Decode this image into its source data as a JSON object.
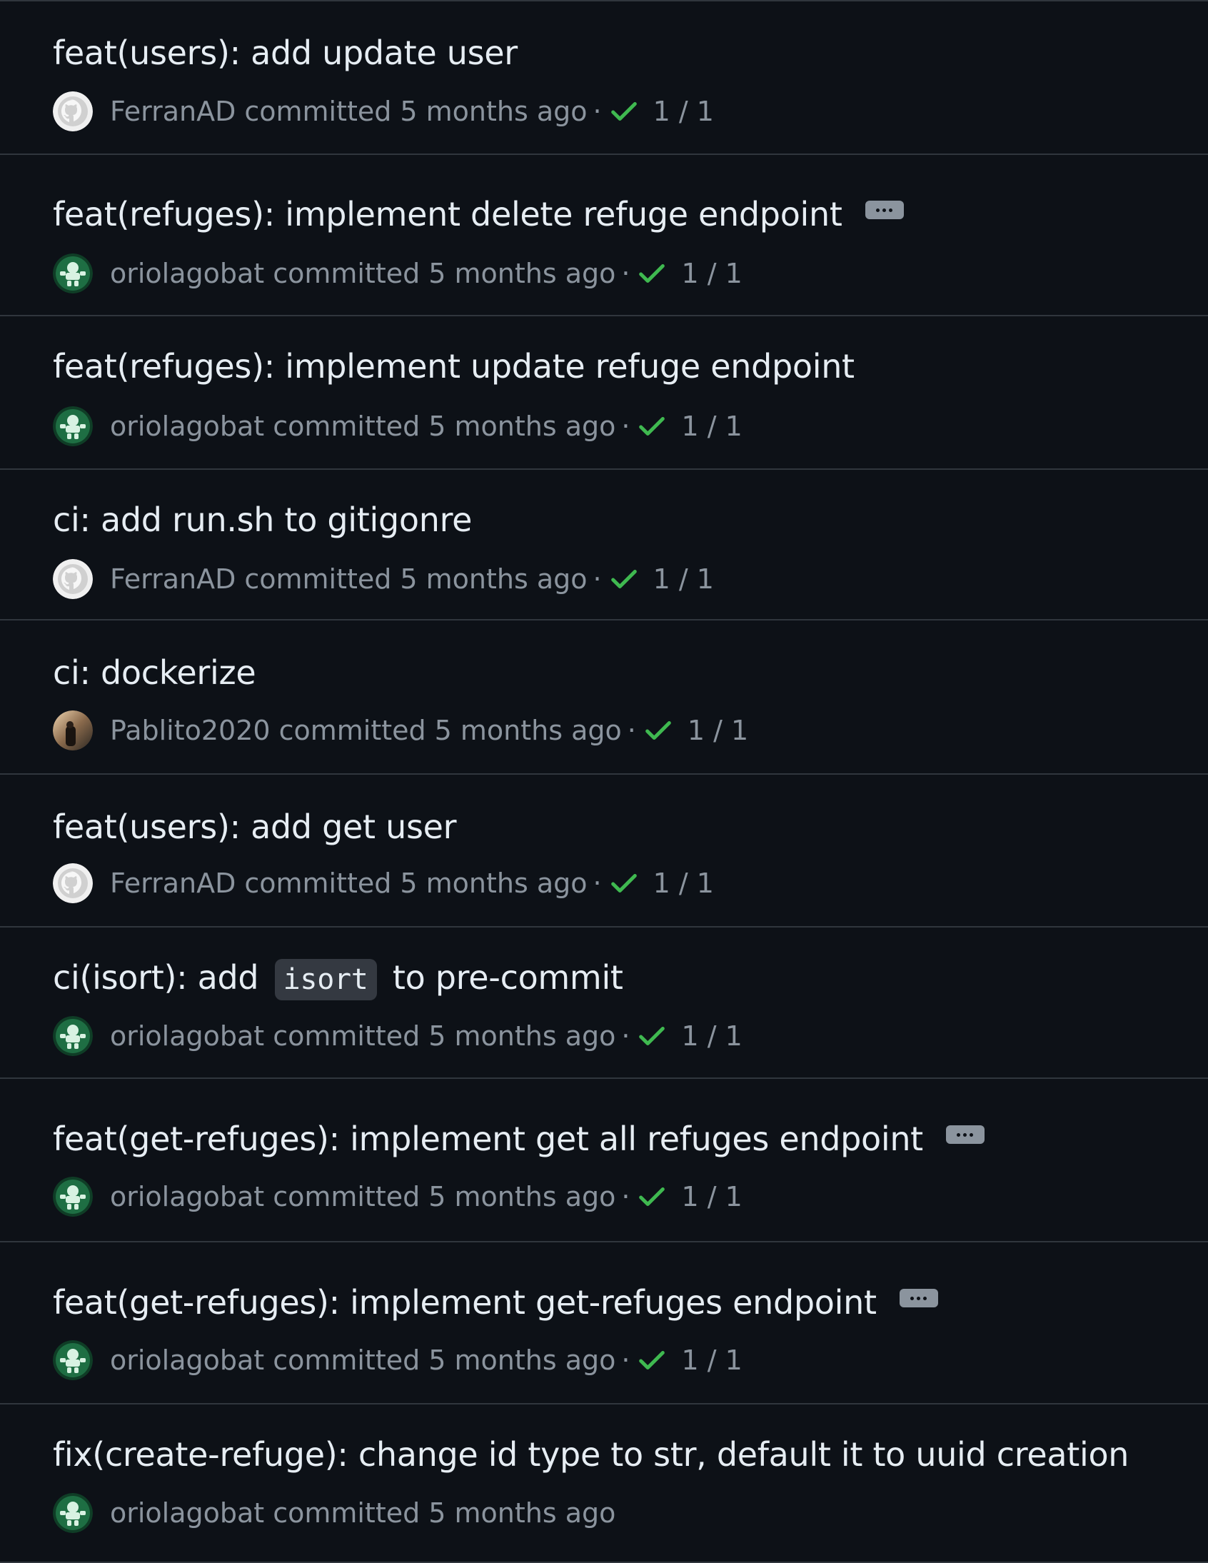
{
  "commits": [
    {
      "title": "feat(users): add update user",
      "title_parts": [],
      "author": "FerranAD",
      "committed_label": "committed",
      "time": "5 months ago",
      "status": "1 / 1",
      "has_ellipsis": false,
      "avatar": "github-default"
    },
    {
      "title": "feat(refuges): implement delete refuge endpoint",
      "title_parts": [],
      "author": "oriolagobat",
      "committed_label": "committed",
      "time": "5 months ago",
      "status": "1 / 1",
      "has_ellipsis": true,
      "avatar": "green-identicon"
    },
    {
      "title": "feat(refuges): implement update refuge endpoint",
      "title_parts": [],
      "author": "oriolagobat",
      "committed_label": "committed",
      "time": "5 months ago",
      "status": "1 / 1",
      "has_ellipsis": false,
      "avatar": "green-identicon"
    },
    {
      "title": "ci: add run.sh to gitigonre",
      "title_parts": [],
      "author": "FerranAD",
      "committed_label": "committed",
      "time": "5 months ago",
      "status": "1 / 1",
      "has_ellipsis": false,
      "avatar": "github-default"
    },
    {
      "title": "ci: dockerize",
      "title_parts": [],
      "author": "Pablito2020",
      "committed_label": "committed",
      "time": "5 months ago",
      "status": "1 / 1",
      "has_ellipsis": false,
      "avatar": "photo"
    },
    {
      "title": "feat(users): add get user",
      "title_parts": [],
      "author": "FerranAD",
      "committed_label": "committed",
      "time": "5 months ago",
      "status": "1 / 1",
      "has_ellipsis": false,
      "avatar": "github-default"
    },
    {
      "title": "",
      "title_parts": [
        {
          "text": "ci(isort): add ",
          "code": false
        },
        {
          "text": "isort",
          "code": true
        },
        {
          "text": " to pre-commit",
          "code": false
        }
      ],
      "author": "oriolagobat",
      "committed_label": "committed",
      "time": "5 months ago",
      "status": "1 / 1",
      "has_ellipsis": false,
      "avatar": "green-identicon"
    },
    {
      "title": "feat(get-refuges): implement get all refuges endpoint",
      "title_parts": [],
      "author": "oriolagobat",
      "committed_label": "committed",
      "time": "5 months ago",
      "status": "1 / 1",
      "has_ellipsis": true,
      "avatar": "green-identicon"
    },
    {
      "title": "feat(get-refuges): implement get-refuges endpoint",
      "title_parts": [],
      "author": "oriolagobat",
      "committed_label": "committed",
      "time": "5 months ago",
      "status": "1 / 1",
      "has_ellipsis": true,
      "avatar": "green-identicon"
    },
    {
      "title": "fix(create-refuge): change id type to str, default it to uuid creation",
      "title_parts": [],
      "author": "oriolagobat",
      "committed_label": "committed",
      "time": "5 months ago",
      "status": "",
      "has_ellipsis": false,
      "avatar": "green-identicon"
    }
  ],
  "colors": {
    "background": "#0d1117",
    "border": "#30363d",
    "text": "#e6edf3",
    "muted": "#8b949e",
    "success": "#3fb950"
  }
}
